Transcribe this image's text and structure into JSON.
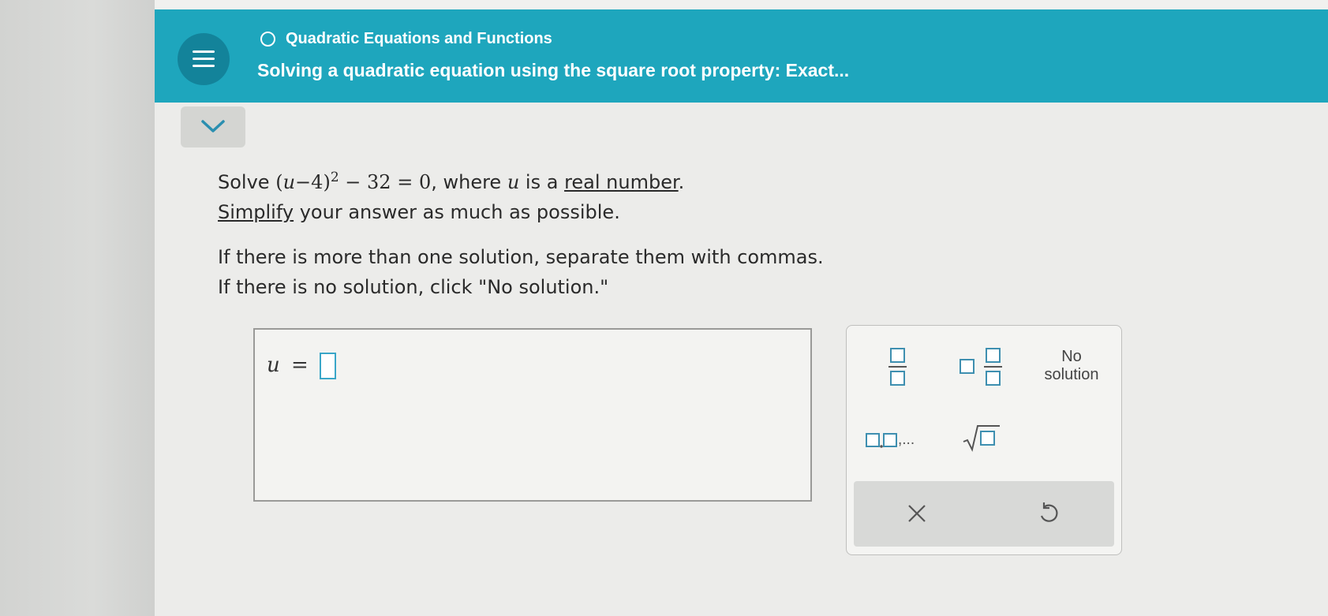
{
  "header": {
    "topic": "Quadratic Equations and Functions",
    "subtopic": "Solving a quadratic equation using the square root property: Exact..."
  },
  "problem": {
    "solve_word": "Solve",
    "equation_lhs_open": "(",
    "var": "u",
    "minus1": "−",
    "four": "4",
    "close": ")",
    "exp": "2",
    "minus2": " − ",
    "thirtytwo": "32",
    "equals": " = ",
    "zero": "0",
    "where_text": ", where ",
    "is_a": " is a ",
    "real_number_link": "real number",
    "period": ".",
    "simplify_link": "Simplify",
    "simplify_rest": " your answer as much as possible.",
    "instruction1": "If there is more than one solution, separate them with commas.",
    "instruction2": "If there is no solution, click \"No solution.\""
  },
  "answer": {
    "var": "u",
    "equals": "=",
    "value": ""
  },
  "keypad": {
    "no_solution_line1": "No",
    "no_solution_line2": "solution",
    "list_dots": ",..."
  },
  "colors": {
    "header": "#1ea6bd",
    "menu_button": "#13839a",
    "input_border": "#3aa6c8"
  }
}
